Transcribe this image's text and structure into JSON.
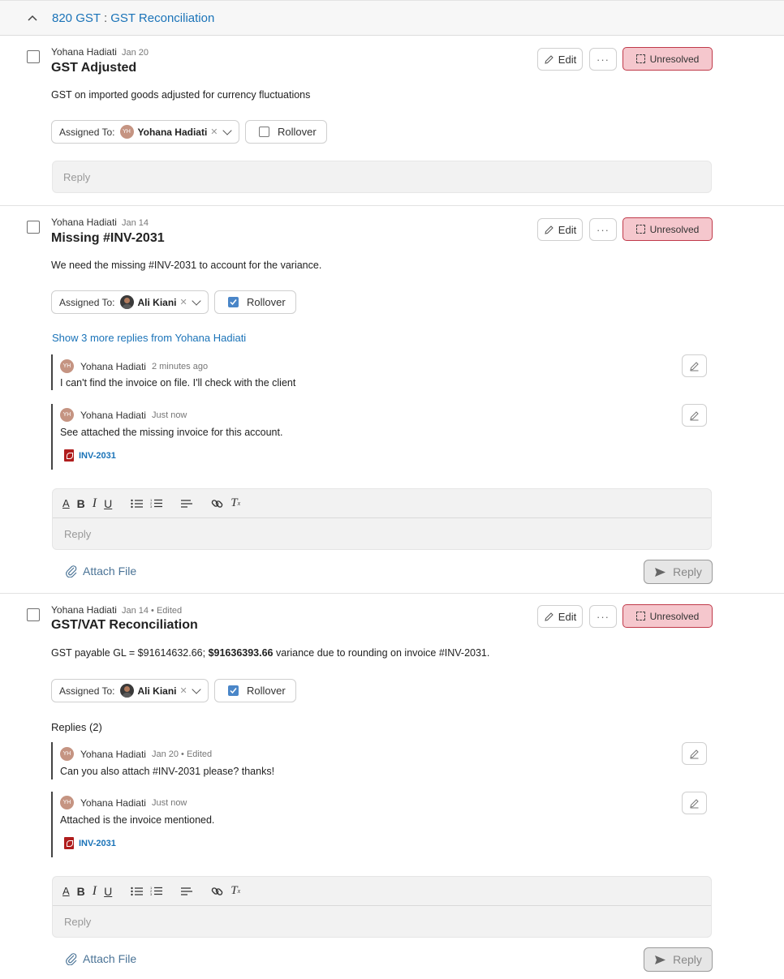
{
  "section": {
    "code": "820 GST",
    "separator": ":",
    "name": "GST Reconciliation"
  },
  "common": {
    "edit_label": "Edit",
    "more_label": "···",
    "unresolved_label": "Unresolved",
    "assigned_label": "Assigned To:",
    "rollover_label": "Rollover",
    "reply_placeholder": "Reply",
    "attach_label": "Attach File",
    "reply_button": "Reply",
    "remove_glyph": "✕"
  },
  "threads": [
    {
      "author": "Yohana Hadiati",
      "date": "Jan 20",
      "title": "GST Adjusted",
      "body": "GST on imported goods adjusted for currency fluctuations",
      "assignee": "Yohana Hadiati",
      "assignee_initials": "YH",
      "rollover_checked": false
    },
    {
      "author": "Yohana Hadiati",
      "date": "Jan 14",
      "title": "Missing #INV-2031",
      "body": "We need the missing #INV-2031 to account for the variance.",
      "assignee": "Ali Kiani",
      "rollover_checked": true,
      "show_more": "Show 3 more replies from Yohana Hadiati",
      "replies": [
        {
          "author": "Yohana Hadiati",
          "initials": "YH",
          "date": "2 minutes ago",
          "text": "I can't find the invoice on file. I'll check with the client"
        },
        {
          "author": "Yohana Hadiati",
          "initials": "YH",
          "date": "Just now",
          "text": "See attached the missing invoice for this account.",
          "file": "INV-2031"
        }
      ]
    },
    {
      "author": "Yohana Hadiati",
      "date": "Jan 14 • Edited",
      "title": "GST/VAT Reconciliation",
      "body_pre": "GST payable GL = $91614632.66; ",
      "body_bold": "$91636393.66",
      "body_post": " variance due to rounding on invoice #INV-2031.",
      "assignee": "Ali Kiani",
      "rollover_checked": true,
      "replies_count": "Replies (2)",
      "replies": [
        {
          "author": "Yohana Hadiati",
          "initials": "YH",
          "date": "Jan 20 • Edited",
          "text": "Can you also attach #INV-2031 please? thanks!"
        },
        {
          "author": "Yohana Hadiati",
          "initials": "YH",
          "date": "Just now",
          "text": "Attached is the invoice mentioned.",
          "file": "INV-2031"
        }
      ]
    }
  ]
}
